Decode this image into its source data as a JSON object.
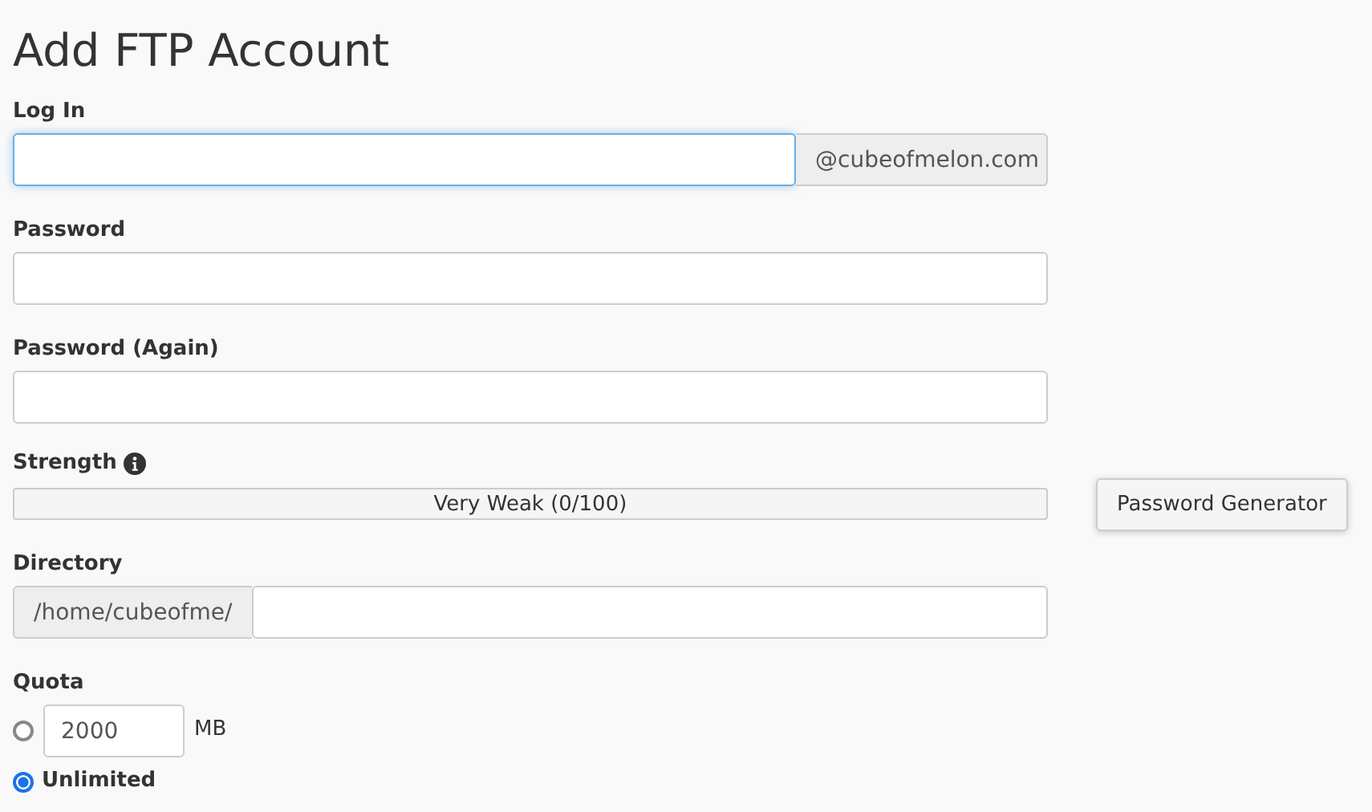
{
  "title": "Add FTP Account",
  "login": {
    "label": "Log In",
    "focused": true,
    "domain": "@cubeofmelon.com"
  },
  "password": {
    "label": "Password"
  },
  "password_again": {
    "label": "Password (Again)"
  },
  "strength": {
    "label": "Strength",
    "level": 0,
    "reading": "Very Weak (0/100)",
    "generator_button": "Password Generator"
  },
  "directory": {
    "label": "Directory",
    "prefix": "/home/cubeofme/"
  },
  "quota": {
    "label": "Quota",
    "options": [
      {
        "kind": "limit",
        "selected": false,
        "value": "2000",
        "unit": "MB"
      },
      {
        "kind": "unlimited",
        "selected": true,
        "label": "Unlimited"
      }
    ]
  }
}
